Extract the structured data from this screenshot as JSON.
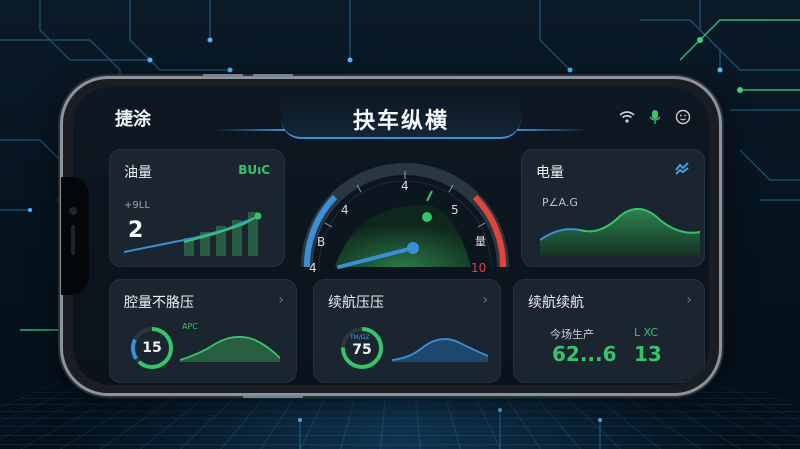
{
  "header": {
    "brand": "捷涂",
    "title": "抉车纵横"
  },
  "status_icons": [
    "wifi-icon",
    "mic-icon",
    "face-icon"
  ],
  "colors": {
    "accent_green": "#35c46a",
    "accent_blue": "#3b8fd6",
    "accent_red": "#e0443a",
    "card_bg": "#1a2530"
  },
  "fuel_card": {
    "title": "油量",
    "badge": "BUıC",
    "small_label": "+9LL",
    "value": "2"
  },
  "power_card": {
    "title": "电量",
    "small_label": "P∠A.G"
  },
  "gauge": {
    "labels": [
      "4",
      "4",
      "5",
      "B",
      "量",
      "4",
      "10"
    ],
    "needle_fraction": 0.55
  },
  "card_pressure": {
    "title": "腔量不胳压",
    "ring_value": "15",
    "mini_label": "APC",
    "ring_fraction": 0.62
  },
  "card_range_pressure": {
    "title": "续航压压",
    "ring_value": "75",
    "mini_label": "TM/ΩZ",
    "ring_fraction": 0.75
  },
  "card_range": {
    "title": "续航续航",
    "left_label": "今场生产",
    "left_value": "62...6",
    "right_label": "L XC",
    "right_value": "13"
  }
}
